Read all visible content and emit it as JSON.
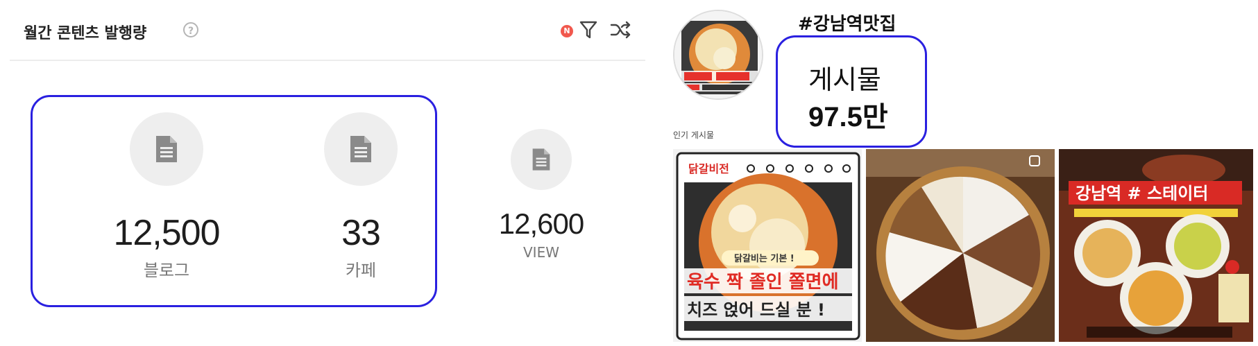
{
  "left_panel": {
    "title": "월간 콘텐츠 발행량",
    "help_symbol": "?",
    "new_badge": "N",
    "stats": {
      "blog": {
        "value": "12,500",
        "label": "블로그"
      },
      "cafe": {
        "value": "33",
        "label": "카페"
      },
      "view": {
        "value": "12,600",
        "label": "VIEW"
      }
    }
  },
  "right_panel": {
    "hashtag": "#강남역맛집",
    "posts": {
      "label": "게시물",
      "count": "97.5만"
    },
    "popular_label": "인기 게시물",
    "thumb1": {
      "brand": "닭갈비전",
      "tagline": "닭갈비는 기본 !",
      "headline_1": "육수 짝 졸인 쫄면에",
      "headline_2": "치즈 얹어 드실 분 !"
    },
    "thumb3": {
      "title": "강남역 # 스테이터"
    }
  },
  "colors": {
    "highlight_border": "#2a20e0",
    "badge_red": "#f1584d",
    "icon_gray": "#888888"
  },
  "icons": [
    "help-icon",
    "filter-icon",
    "shuffle-icon",
    "document-icon"
  ]
}
